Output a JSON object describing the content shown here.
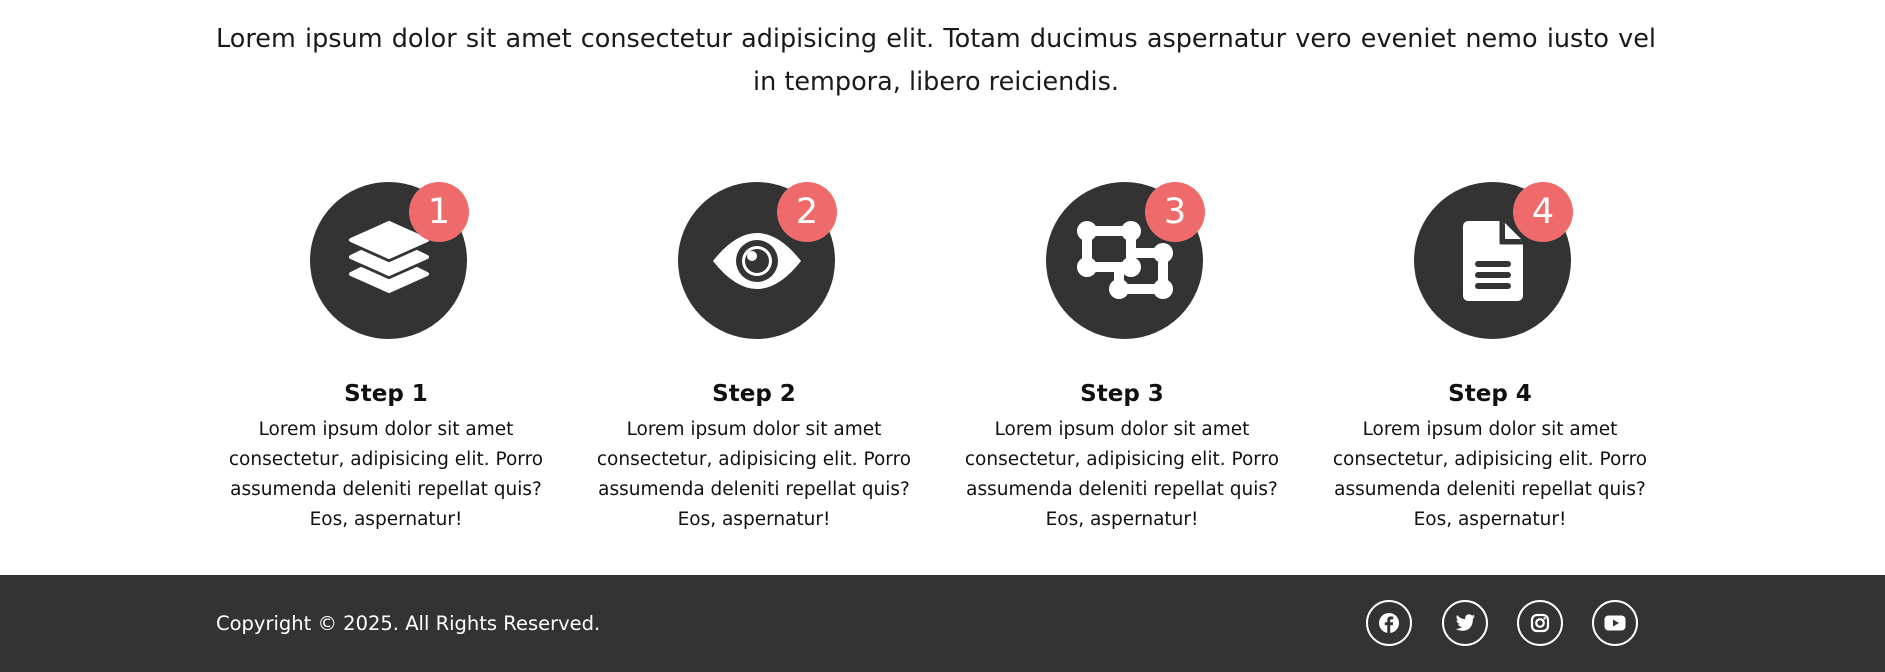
{
  "intro": {
    "text": "Lorem ipsum dolor sit amet consectetur adipisicing elit. Totam ducimus aspernatur vero eveniet nemo iusto vel in tempora, libero reiciendis."
  },
  "colors": {
    "dark": "#333333",
    "accent": "#ef6b6b",
    "light": "#ffffff"
  },
  "steps": [
    {
      "number": "1",
      "title": "Step 1",
      "icon": "layers-icon",
      "text": "Lorem ipsum dolor sit amet consectetur, adipisicing elit. Porro assumenda deleniti repellat quis? Eos, aspernatur!"
    },
    {
      "number": "2",
      "title": "Step 2",
      "icon": "eye-icon",
      "text": "Lorem ipsum dolor sit amet consectetur, adipisicing elit. Porro assumenda deleniti repellat quis? Eos, aspernatur!"
    },
    {
      "number": "3",
      "title": "Step 3",
      "icon": "object-group-icon",
      "text": "Lorem ipsum dolor sit amet consectetur, adipisicing elit. Porro assumenda deleniti repellat quis? Eos, aspernatur!"
    },
    {
      "number": "4",
      "title": "Step 4",
      "icon": "file-lines-icon",
      "text": "Lorem ipsum dolor sit amet consectetur, adipisicing elit. Porro assumenda deleniti repellat quis? Eos, aspernatur!"
    }
  ],
  "footer": {
    "copyright": "Copyright © 2025. All Rights Reserved.",
    "social": [
      {
        "icon": "facebook-icon"
      },
      {
        "icon": "twitter-icon"
      },
      {
        "icon": "instagram-icon"
      },
      {
        "icon": "youtube-icon"
      }
    ]
  }
}
